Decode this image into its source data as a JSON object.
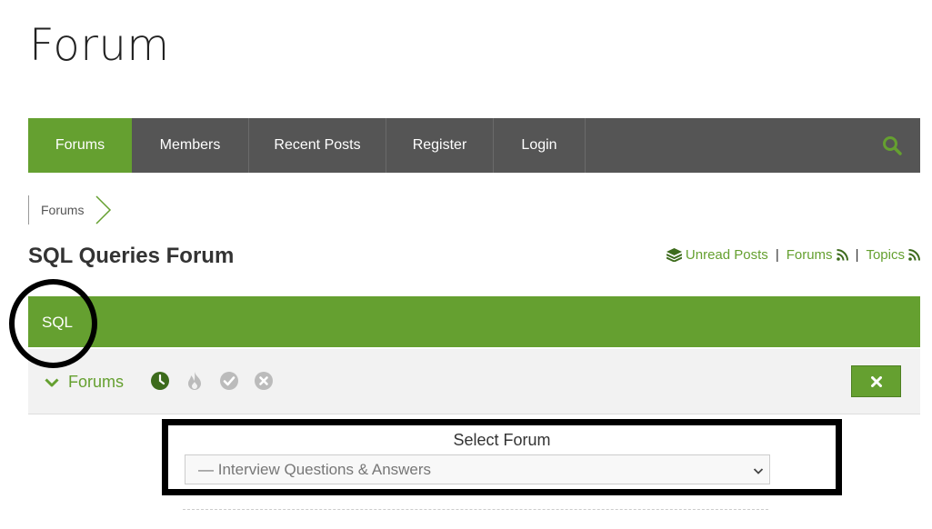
{
  "page": {
    "title": "Forum"
  },
  "nav": {
    "items": [
      {
        "label": "Forums",
        "active": true
      },
      {
        "label": "Members",
        "active": false
      },
      {
        "label": "Recent Posts",
        "active": false
      },
      {
        "label": "Register",
        "active": false
      },
      {
        "label": "Login",
        "active": false
      }
    ],
    "search_icon": "search-icon"
  },
  "breadcrumb": {
    "items": [
      "Forums"
    ]
  },
  "forum": {
    "title": "SQL Queries Forum"
  },
  "top_links": {
    "unread": "Unread Posts",
    "forums": "Forums",
    "topics": "Topics",
    "separator": "|"
  },
  "category": {
    "label": "SQL"
  },
  "subbar": {
    "toggle_label": "Forums",
    "filter_icons": [
      "clock-icon",
      "fire-icon",
      "check-circle-icon",
      "x-circle-icon"
    ],
    "close_icon": "close-icon"
  },
  "select": {
    "label": "Select Forum",
    "value": "— Interview Questions & Answers"
  },
  "colors": {
    "accent": "#65a030",
    "nav_bg": "#555555",
    "subbar_bg": "#f2f2f2"
  }
}
